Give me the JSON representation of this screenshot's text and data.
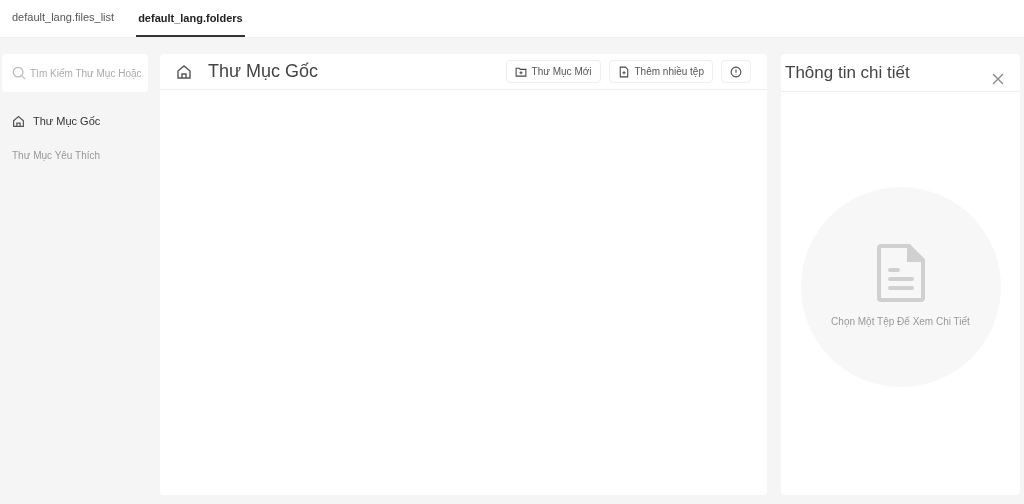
{
  "tabs": [
    {
      "label": "default_lang.files_list",
      "selected": false
    },
    {
      "label": "default_lang.folders",
      "selected": true
    }
  ],
  "sidebar": {
    "search": {
      "placeholder": "Tìm Kiếm Thư Mục Hoặc"
    },
    "items": [
      {
        "label": "Thư Mục Gốc",
        "selected": true
      },
      {
        "label": "Thư Mục Yêu Thích",
        "selected": false
      }
    ]
  },
  "main": {
    "title": "Thư Mục Gốc",
    "buttons": [
      {
        "kind": "new-folder",
        "label": "Thư Mục Mới"
      },
      {
        "kind": "add-files",
        "label": "Thêm nhiều tệp"
      },
      {
        "kind": "info"
      }
    ]
  },
  "details": {
    "title": "Thông tin chi tiết",
    "empty_message": "Chọn Một Tệp Để Xem Chi Tiết"
  }
}
